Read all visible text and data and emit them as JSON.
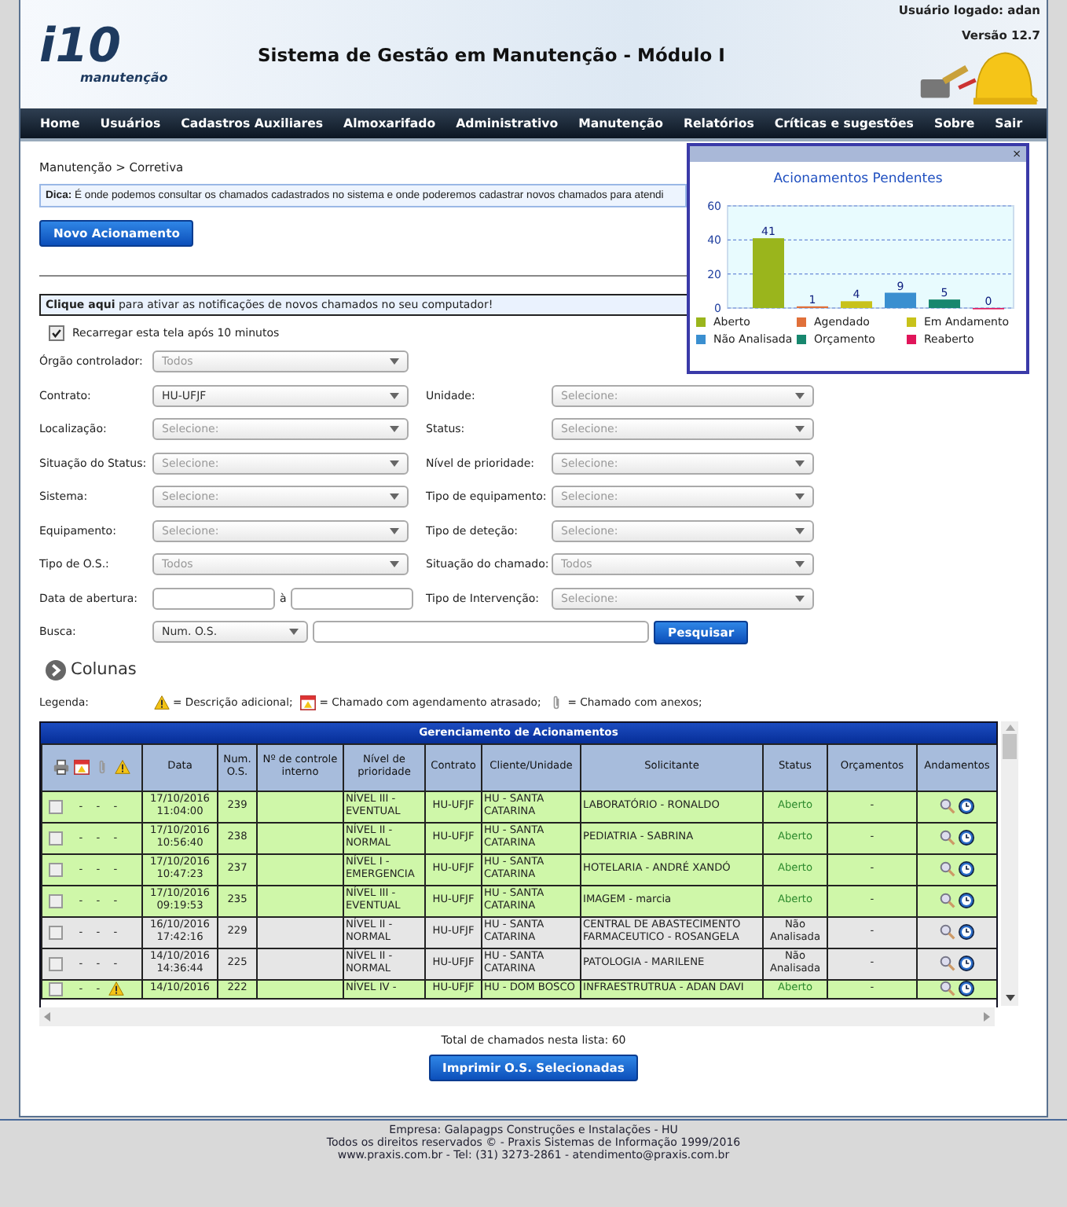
{
  "header": {
    "logo_text": "i10",
    "logo_subtext": "manutenção",
    "title": "Sistema de Gestão em Manutenção - Módulo I",
    "user": "Usuário logado: adan",
    "version": "Versão 12.7"
  },
  "nav": [
    "Home",
    "Usuários",
    "Cadastros Auxiliares",
    "Almoxarifado",
    "Administrativo",
    "Manutenção",
    "Relatórios",
    "Críticas e sugestões",
    "Sobre",
    "Sair"
  ],
  "breadcrumb": "Manutenção > Corretiva",
  "tip": "**Dica:** É onde podemos consultar os chamados cadastrados no sistema e onde poderemos cadastrar novos chamados para atendi",
  "new_button": "Novo Acionamento",
  "notification": "**Clique aqui** para ativar as notificações de novos chamados no seu computador!",
  "reload": {
    "label": "Recarregar esta tela após 10 minutos",
    "checked": true
  },
  "filter_rows": [
    [
      {
        "label": "Órgão controlador:",
        "placeholder": "Todos"
      }
    ],
    [
      {
        "label": "Contrato:",
        "value": "HU-UFJF"
      },
      {
        "label": "Unidade:",
        "placeholder": "Selecione:"
      }
    ],
    [
      {
        "label": "Localização:",
        "placeholder": "Selecione:"
      },
      {
        "label": "Status:",
        "placeholder": "Selecione:"
      }
    ],
    [
      {
        "label": "Situação do Status:",
        "placeholder": "Selecione:"
      },
      {
        "label": "Nível de prioridade:",
        "placeholder": "Selecione:"
      }
    ],
    [
      {
        "label": "Sistema:",
        "placeholder": "Selecione:"
      },
      {
        "label": "Tipo de equipamento:",
        "placeholder": "Selecione:"
      }
    ],
    [
      {
        "label": "Equipamento:",
        "placeholder": "Selecione:"
      },
      {
        "label": "Tipo de deteção:",
        "placeholder": "Selecione:"
      }
    ],
    [
      {
        "label": "Tipo de O.S.:",
        "placeholder": "Todos"
      },
      {
        "label": "Situação do chamado:",
        "placeholder": "Todos"
      }
    ],
    [
      {
        "label": "Data de abertura:",
        "kind": "date_range",
        "separator": "à"
      },
      {
        "label": "Tipo de Intervenção:",
        "placeholder": "Selecione:"
      }
    ]
  ],
  "search": {
    "label": "Busca:",
    "field": "Num. O.S.",
    "button": "Pesquisar"
  },
  "columns_toggle": "Colunas",
  "legend": {
    "label": "Legenda:",
    "items": [
      "= Descrição adicional;",
      "= Chamado com agendamento atrasado;",
      "= Chamado com anexos;"
    ]
  },
  "table": {
    "title": "Gerenciamento de Acionamentos",
    "columns": [
      "Data",
      "Num. O.S.",
      "Nº de controle interno",
      "Nível de prioridade",
      "Contrato",
      "Cliente/Unidade",
      "Solicitante",
      "Status",
      "Orçamentos",
      "Andamentos"
    ],
    "rows": [
      {
        "kind": "open",
        "checked": false,
        "marks": [
          "-",
          "-",
          "-"
        ],
        "warning": false,
        "date": "17/10/2016 11:04:00",
        "os": "239",
        "priority": "NÍVEL III - EVENTUAL",
        "contract": "HU-UFJF",
        "client": "HU - SANTA CATARINA",
        "requester": "LABORATÓRIO - RONALDO",
        "status": "Aberto",
        "budgets": "-"
      },
      {
        "kind": "open",
        "checked": false,
        "marks": [
          "-",
          "-",
          "-"
        ],
        "warning": false,
        "date": "17/10/2016 10:56:40",
        "os": "238",
        "priority": "NÍVEL II - NORMAL",
        "contract": "HU-UFJF",
        "client": "HU - SANTA CATARINA",
        "requester": "PEDIATRIA - SABRINA",
        "status": "Aberto",
        "budgets": "-"
      },
      {
        "kind": "open",
        "checked": false,
        "marks": [
          "-",
          "-",
          "-"
        ],
        "warning": false,
        "date": "17/10/2016 10:47:23",
        "os": "237",
        "priority": "NÍVEL I - EMERGENCIA",
        "contract": "HU-UFJF",
        "client": "HU - SANTA CATARINA",
        "requester": "HOTELARIA - ANDRÉ XANDÓ",
        "status": "Aberto",
        "budgets": "-"
      },
      {
        "kind": "open",
        "checked": false,
        "marks": [
          "-",
          "-",
          "-"
        ],
        "warning": false,
        "date": "17/10/2016 09:19:53",
        "os": "235",
        "priority": "NÍVEL III - EVENTUAL",
        "contract": "HU-UFJF",
        "client": "HU - SANTA CATARINA",
        "requester": "IMAGEM - marcia",
        "status": "Aberto",
        "budgets": "-"
      },
      {
        "kind": "pending",
        "checked": false,
        "marks": [
          "-",
          "-",
          "-"
        ],
        "warning": false,
        "date": "16/10/2016 17:42:16",
        "os": "229",
        "priority": "NÍVEL II - NORMAL",
        "contract": "HU-UFJF",
        "client": "HU - SANTA CATARINA",
        "requester": "CENTRAL DE ABASTECIMENTO FARMACEUTICO - ROSANGELA",
        "status": "Não Analisada",
        "budgets": "-"
      },
      {
        "kind": "pending",
        "checked": false,
        "marks": [
          "-",
          "-",
          "-"
        ],
        "warning": false,
        "date": "14/10/2016 14:36:44",
        "os": "225",
        "priority": "NÍVEL II - NORMAL",
        "contract": "HU-UFJF",
        "client": "HU - SANTA CATARINA",
        "requester": "PATOLOGIA - MARILENE",
        "status": "Não Analisada",
        "budgets": "-"
      },
      {
        "kind": "open",
        "checked": false,
        "marks": [
          "-",
          "-"
        ],
        "warning": true,
        "date": "14/10/2016",
        "os": "222",
        "priority": "NÍVEL IV -",
        "contract": "HU-UFJF",
        "client": "HU - DOM BOSCO",
        "requester": "INFRAESTRUTRUA - ADAN DAVI",
        "status": "Aberto",
        "budgets": "-"
      }
    ]
  },
  "total": "Total de chamados nesta lista: 60",
  "print_button": "Imprimir O.S. Selecionadas",
  "footer": [
    "Empresa: Galapagps Construções e Instalações - HU",
    "Todos os direitos reservados © - Praxis Sistemas de Informação 1999/2016",
    "www.praxis.com.br - Tel: (31) 3273-2861 - atendimento@praxis.com.br"
  ],
  "popup": {
    "close": "×",
    "chart_data": {
      "type": "bar",
      "title": "Acionamentos Pendentes",
      "series": [
        {
          "name": "Aberto",
          "color": "#9ab51c",
          "values": [
            41
          ]
        },
        {
          "name": "Agendado",
          "color": "#e0703a",
          "values": [
            1
          ]
        },
        {
          "name": "Em Andamento",
          "color": "#c8c21a",
          "values": [
            4
          ]
        },
        {
          "name": "Não Analisada",
          "color": "#3a8fd0",
          "values": [
            9
          ]
        },
        {
          "name": "Orçamento",
          "color": "#17876e",
          "values": [
            5
          ]
        },
        {
          "name": "Reaberto",
          "color": "#e0155a",
          "values": [
            0
          ]
        }
      ],
      "ylim": [
        0,
        60
      ],
      "yticks": [
        0,
        20,
        40,
        60
      ],
      "data_labels": true
    }
  }
}
